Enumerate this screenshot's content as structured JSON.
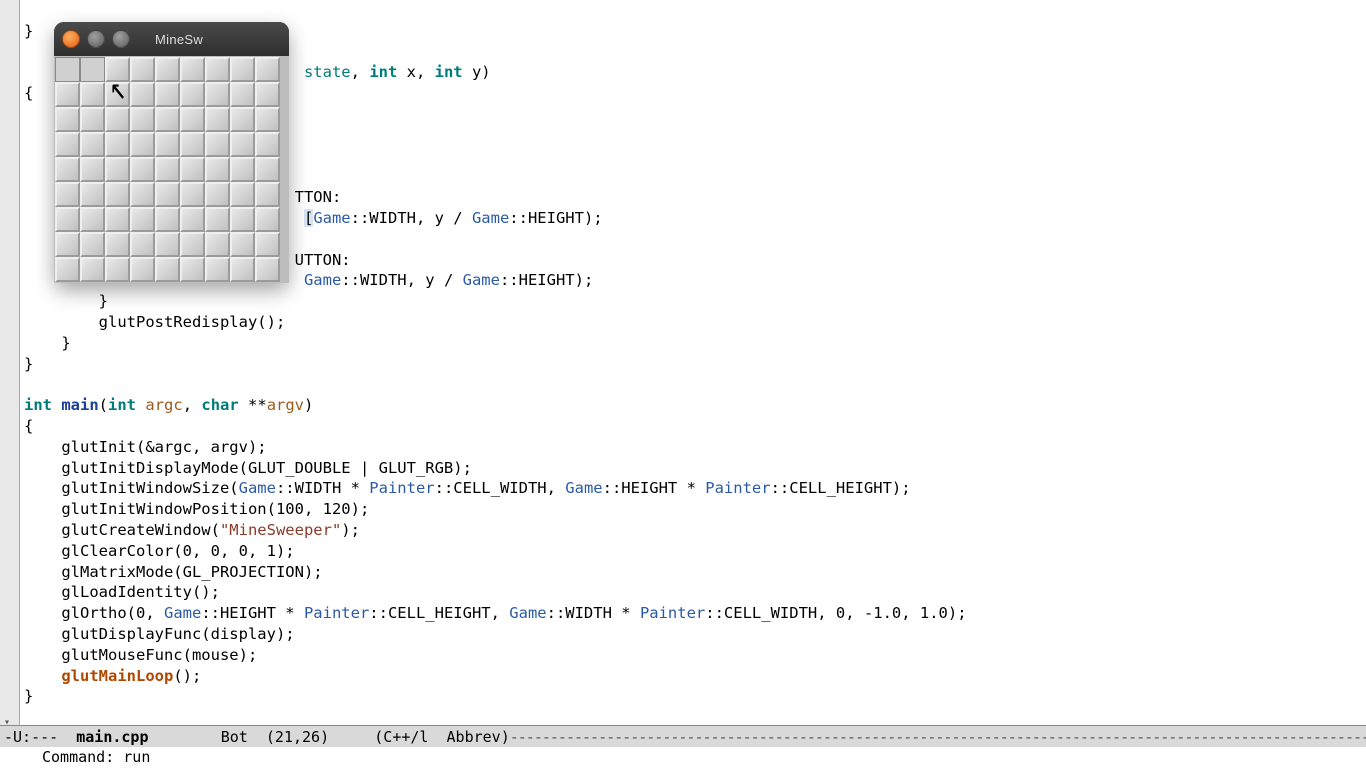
{
  "editor": {
    "file": "main.cpp",
    "modeline_left": "-U:---",
    "modeline_pos": "Bot",
    "modeline_cursor": "(21,26)",
    "modeline_mode": "(C++/l  Abbrev)",
    "minibuf_label": "Command:",
    "minibuf_value": "run"
  },
  "ms": {
    "title": "MineSw",
    "rows": 9,
    "cols": 9,
    "revealed_cells": [
      0,
      1
    ]
  },
  "code": {
    "l0": "}",
    "l1_a": "                              ",
    "l1_b": "state",
    "l1_c": ", ",
    "l1_d": "int",
    "l1_e": " x, ",
    "l1_f": "int",
    "l1_g": " y)",
    "l2": "{",
    "l4a": "                             TTON:",
    "l4b_pre": "                              ",
    "l4b_g1": "Game",
    "l4b_mid": "::WIDTH, y / ",
    "l4b_g2": "Game",
    "l4b_end": "::HEIGHT);",
    "l5a": "                             UTTON:",
    "l5b_pre": "                              ",
    "l5b_g1": "Game",
    "l5b_mid": "::WIDTH, y / ",
    "l5b_g2": "Game",
    "l5b_end": "::HEIGHT);",
    "l6": "        }",
    "l7": "        glutPostRedisplay();",
    "l8": "    }",
    "l9": "}",
    "l11_a": "int",
    "l11_b": " ",
    "l11_c": "main",
    "l11_d": "(",
    "l11_e": "int",
    "l11_f": " ",
    "l11_g": "argc",
    "l11_h": ", ",
    "l11_i": "char",
    "l11_j": " **",
    "l11_k": "argv",
    "l11_l": ")",
    "l12": "{",
    "l13": "    glutInit(&argc, argv);",
    "l14": "    glutInitDisplayMode(GLUT_DOUBLE | GLUT_RGB);",
    "l15_a": "    glutInitWindowSize(",
    "l15_b": "Game",
    "l15_c": "::WIDTH * ",
    "l15_d": "Painter",
    "l15_e": "::CELL_WIDTH, ",
    "l15_f": "Game",
    "l15_g": "::HEIGHT * ",
    "l15_h": "Painter",
    "l15_i": "::CELL_HEIGHT);",
    "l16": "    glutInitWindowPosition(100, 120);",
    "l17_a": "    glutCreateWindow(",
    "l17_b": "\"MineSweeper\"",
    "l17_c": ");",
    "l18": "    glClearColor(0, 0, 0, 1);",
    "l19": "    glMatrixMode(GL_PROJECTION);",
    "l20": "    glLoadIdentity();",
    "l21_a": "    glOrtho(0, ",
    "l21_b": "Game",
    "l21_c": "::HEIGHT * ",
    "l21_d": "Painter",
    "l21_e": "::CELL_HEIGHT, ",
    "l21_f": "Game",
    "l21_g": "::WIDTH * ",
    "l21_h": "Painter",
    "l21_i": "::CELL_WIDTH, 0, -1.0, 1.0);",
    "l22": "    glutDisplayFunc(display);",
    "l23": "    glutMouseFunc(mouse);",
    "l24_a": "    ",
    "l24_b": "glutMainLoop",
    "l24_c": "();",
    "l25": "}"
  }
}
